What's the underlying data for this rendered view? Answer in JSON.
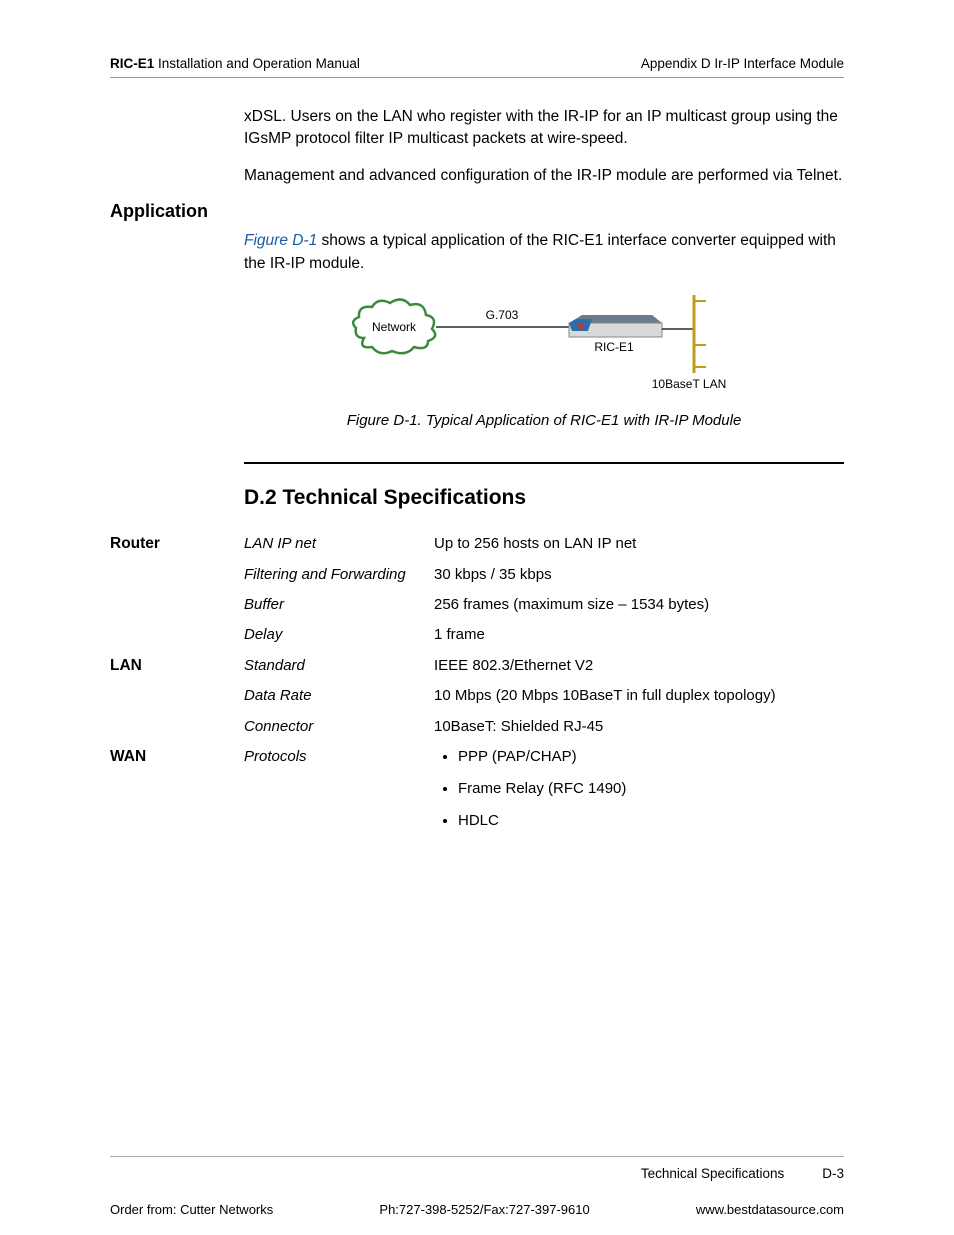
{
  "header": {
    "left_bold": "RIC-E1",
    "left_rest": " Installation and Operation Manual",
    "right": "Appendix D  Ir-IP Interface Module"
  },
  "intro": {
    "p1": "xDSL. Users on the LAN who register with the IR-IP for an IP multicast group using the IGsMP protocol filter IP multicast packets at wire-speed.",
    "p2": "Management and advanced configuration of the IR-IP module are performed via Telnet."
  },
  "application": {
    "heading": "Application",
    "fig_link": "Figure D-1",
    "para_rest": " shows a typical application of the RIC-E1 interface converter equipped with the IR-IP module.",
    "caption": "Figure D-1.  Typical Application of RIC-E1 with IR-IP Module",
    "diagram": {
      "network": "Network",
      "g703": "G.703",
      "device": "RIC-E1",
      "lan": "10BaseT LAN"
    }
  },
  "section": {
    "title": "D.2  Technical Specifications"
  },
  "specs": [
    {
      "cat": "Router",
      "label": "LAN IP net",
      "value": "Up to 256 hosts on LAN IP net"
    },
    {
      "cat": "",
      "label": "Filtering and Forwarding",
      "value": "30 kbps / 35 kbps"
    },
    {
      "cat": "",
      "label": "Buffer",
      "value": "256 frames (maximum size – 1534 bytes)"
    },
    {
      "cat": "",
      "label": "Delay",
      "value": "1 frame"
    },
    {
      "cat": "LAN",
      "label": "Standard",
      "value": "IEEE 802.3/Ethernet V2"
    },
    {
      "cat": "",
      "label": "Data Rate",
      "value": "10 Mbps (20 Mbps 10BaseT in full duplex topology)"
    },
    {
      "cat": "",
      "label": "Connector",
      "value": "10BaseT: Shielded RJ-45"
    },
    {
      "cat": "WAN",
      "label": "Protocols",
      "list": [
        "PPP (PAP/CHAP)",
        "Frame Relay (RFC 1490)",
        "HDLC"
      ]
    }
  ],
  "footer": {
    "section": "Technical Specifications",
    "page": "D-3",
    "order": "Order from: Cutter Networks",
    "phone": "Ph:727-398-5252/Fax:727-397-9610",
    "url": "www.bestdatasource.com"
  }
}
